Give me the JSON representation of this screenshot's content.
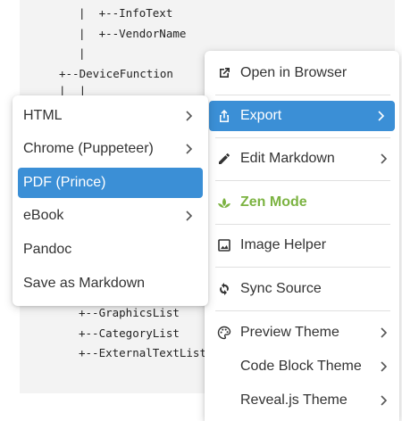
{
  "code_lines": [
    "|  +--InfoText",
    "|  +--VendorName",
    "|",
    "+--DeviceFunction",
    "|  |",
    "+--GraphicsList",
    "+--CategoryList",
    "+--ExternalTextList"
  ],
  "main_menu": {
    "open_in_browser": "Open in Browser",
    "export": "Export",
    "edit_markdown": "Edit Markdown",
    "zen_mode": "Zen Mode",
    "image_helper": "Image Helper",
    "sync_source": "Sync Source",
    "preview_theme": "Preview Theme",
    "code_block_theme": "Code Block Theme",
    "reveal_theme": "Reveal.js Theme"
  },
  "export_submenu": {
    "html": "HTML",
    "chrome": "Chrome (Puppeteer)",
    "pdf": "PDF (Prince)",
    "ebook": "eBook",
    "pandoc": "Pandoc",
    "save_markdown": "Save as Markdown"
  },
  "colors": {
    "active": "#3b8fd6",
    "zen": "#7cb342",
    "code_bg": "#f3f3f3"
  },
  "icons": {
    "open_in_browser": "open-external-icon",
    "export": "export-icon",
    "edit_markdown": "pencil-icon",
    "zen_mode": "lotus-icon",
    "image_helper": "image-icon",
    "sync_source": "sync-icon",
    "preview_theme": "palette-icon"
  }
}
